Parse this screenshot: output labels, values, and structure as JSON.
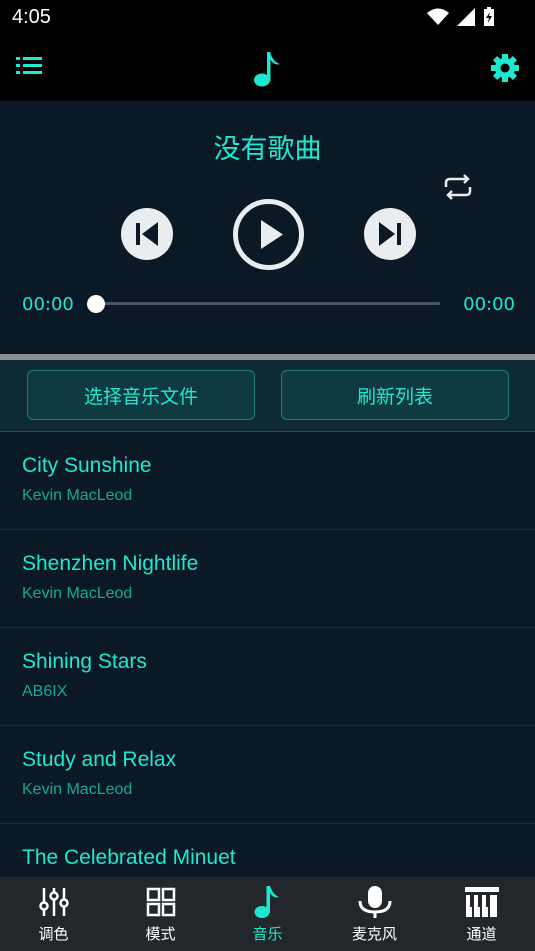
{
  "status_bar": {
    "time": "4:05"
  },
  "player": {
    "title": "没有歌曲",
    "current_time": "00:00",
    "total_time": "00:00",
    "progress": 0
  },
  "buttons": {
    "select_file": "选择音乐文件",
    "refresh_list": "刷新列表"
  },
  "songs": [
    {
      "title": "City Sunshine",
      "artist": "Kevin MacLeod"
    },
    {
      "title": "Shenzhen Nightlife",
      "artist": "Kevin MacLeod"
    },
    {
      "title": "Shining Stars",
      "artist": "AB6IX"
    },
    {
      "title": "Study and Relax",
      "artist": "Kevin MacLeod"
    },
    {
      "title": "The Celebrated Minuet",
      "artist": ""
    }
  ],
  "nav": [
    {
      "label": "调色",
      "icon": "sliders-icon"
    },
    {
      "label": "模式",
      "icon": "grid-icon"
    },
    {
      "label": "音乐",
      "icon": "music-note-icon",
      "active": true
    },
    {
      "label": "麦克风",
      "icon": "microphone-icon"
    },
    {
      "label": "通道",
      "icon": "piano-icon"
    }
  ],
  "colors": {
    "accent": "#1de9d0",
    "background": "#0b1826",
    "nav_bg": "#23272b"
  }
}
